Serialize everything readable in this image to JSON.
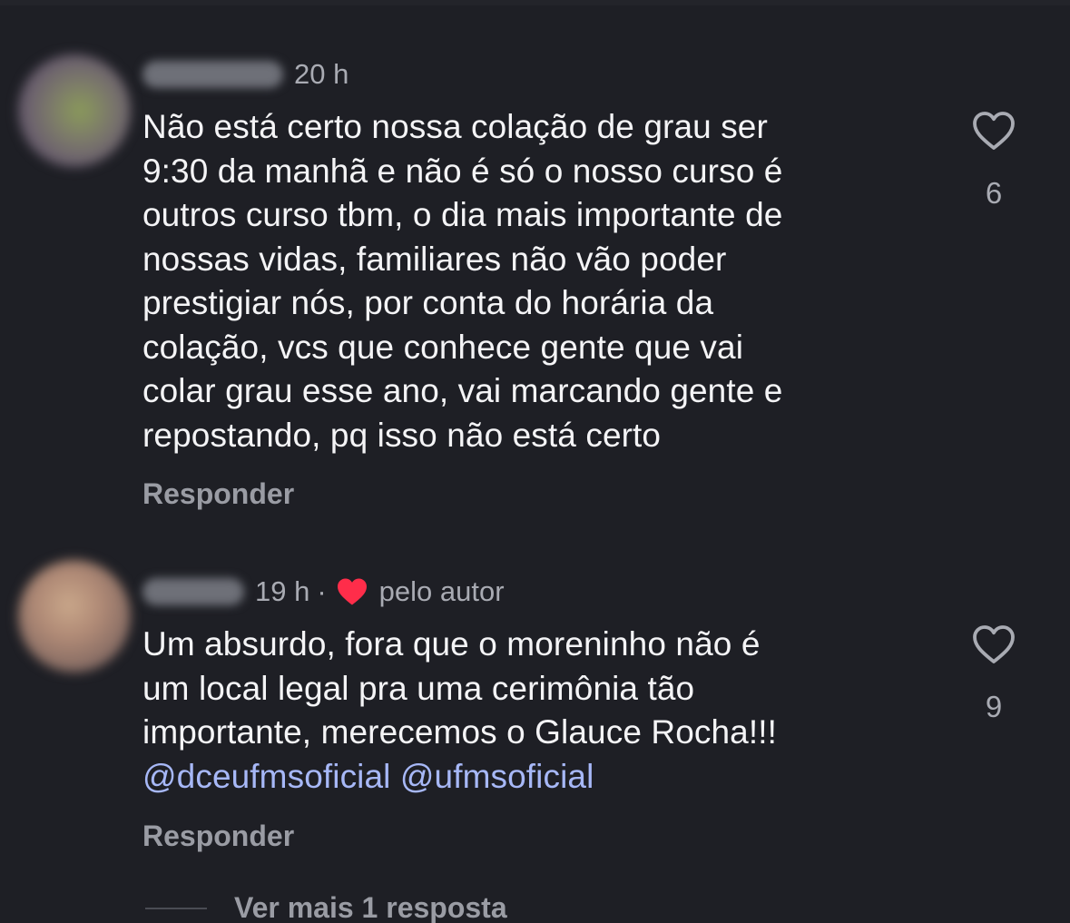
{
  "comments": [
    {
      "time": "20 h",
      "liked_by_author": false,
      "lines": [
        "Não está certo nossa colação de grau ser",
        "9:30 da manhã e não é só o nosso curso é",
        "outros curso tbm, o dia mais importante de",
        "nossas vidas, familiares não vão poder",
        "prestigiar nós, por conta do horária da",
        "colação, vcs que conhece gente que vai",
        "colar grau esse ano, vai marcando gente e",
        "repostando, pq isso não está certo"
      ],
      "reply_label": "Responder",
      "like_count": "6"
    },
    {
      "time": "19 h",
      "separator": "·",
      "liked_by_author": true,
      "author_like_label": "pelo autor",
      "lines": [
        "Um absurdo, fora que o moreninho não é",
        "um local legal pra uma cerimônia tão",
        "importante, merecemos o Glauce Rocha!!!"
      ],
      "mentions": [
        "@dceufmsoficial",
        "@ufmsoficial"
      ],
      "reply_label": "Responder",
      "like_count": "9"
    }
  ],
  "more_replies_label": "Ver mais 1 resposta",
  "colors": {
    "background": "#1e1f25",
    "text": "#f4f4f6",
    "muted": "#a9abb3",
    "mention": "#a7b8f7",
    "heart_red": "#ff2d4a"
  }
}
